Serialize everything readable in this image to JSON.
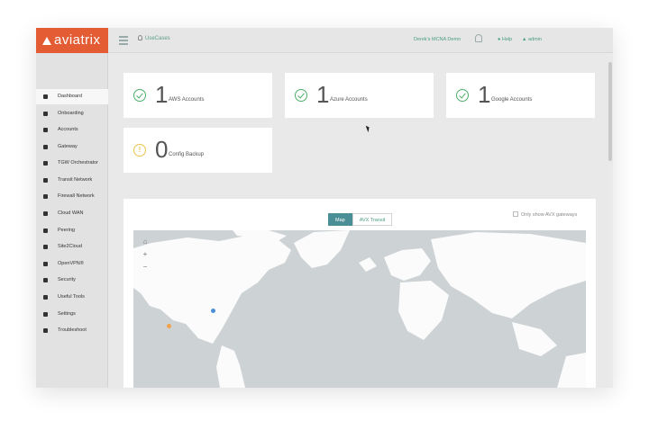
{
  "app": {
    "brand": "aviatrix",
    "brand_color": "#e35c34"
  },
  "topbar": {
    "usecases_label": "UseCases",
    "account_name": "Derek's MCNA Demo",
    "help_label": "Help",
    "user_label": "admin"
  },
  "sidebar": {
    "items": [
      {
        "label": "Dashboard",
        "icon": "home-icon",
        "active": true
      },
      {
        "label": "Onboarding",
        "icon": "plus-icon"
      },
      {
        "label": "Accounts",
        "icon": "accounts-icon"
      },
      {
        "label": "Gateway",
        "icon": "gateway-icon"
      },
      {
        "label": "TGW Orchestrator",
        "icon": "tgw-icon"
      },
      {
        "label": "Transit Network",
        "icon": "transit-icon"
      },
      {
        "label": "Firewall Network",
        "icon": "firewall-icon"
      },
      {
        "label": "Cloud WAN",
        "icon": "cloud-icon"
      },
      {
        "label": "Peering",
        "icon": "peering-icon"
      },
      {
        "label": "Site2Cloud",
        "icon": "site2cloud-icon"
      },
      {
        "label": "OpenVPN®",
        "icon": "openvpn-icon"
      },
      {
        "label": "Security",
        "icon": "key-icon"
      },
      {
        "label": "Useful Tools",
        "icon": "tools-icon"
      },
      {
        "label": "Settings",
        "icon": "gear-icon"
      },
      {
        "label": "Troubleshoot",
        "icon": "wrench-icon"
      }
    ]
  },
  "cards": [
    {
      "count": "1",
      "label": "AWS Accounts",
      "status": "ok"
    },
    {
      "count": "1",
      "label": "Azure Accounts",
      "status": "ok"
    },
    {
      "count": "1",
      "label": "Google Accounts",
      "status": "ok"
    },
    {
      "count": "0",
      "label": "Config Backup",
      "status": "warn"
    }
  ],
  "map_panel": {
    "tabs": [
      {
        "label": "Map",
        "active": true
      },
      {
        "label": "AVX Transit",
        "active": false
      }
    ],
    "only_show_label": "Only show AVX gateways",
    "zoom_in": "+",
    "zoom_out": "−",
    "markers": [
      {
        "color": "#f0a24a"
      },
      {
        "color": "#4a90d9"
      }
    ]
  }
}
